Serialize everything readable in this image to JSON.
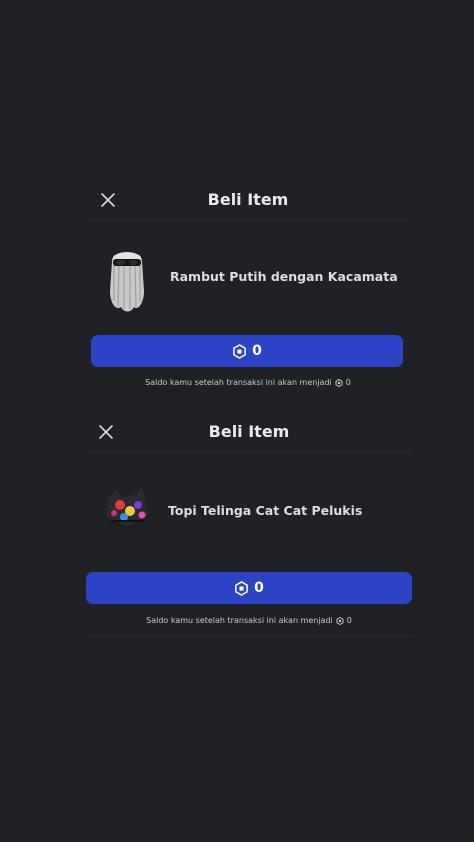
{
  "dialogs": [
    {
      "title": "Beli Item",
      "item_name": "Rambut Putih dengan Kacamata",
      "price": "0",
      "balance_note": "Saldo kamu setelah transaksi ini akan menjadi",
      "balance_value": "0",
      "thumb_icon": "white-hair-sunglasses-thumbnail"
    },
    {
      "title": "Beli Item",
      "item_name": "Topi Telinga Cat Cat Pelukis",
      "price": "0",
      "balance_note": "Saldo kamu setelah transaksi ini akan menjadi",
      "balance_value": "0",
      "thumb_icon": "paint-cat-ear-hat-thumbnail"
    }
  ],
  "colors": {
    "background": "#202125",
    "buy_button": "#2b43c6"
  }
}
